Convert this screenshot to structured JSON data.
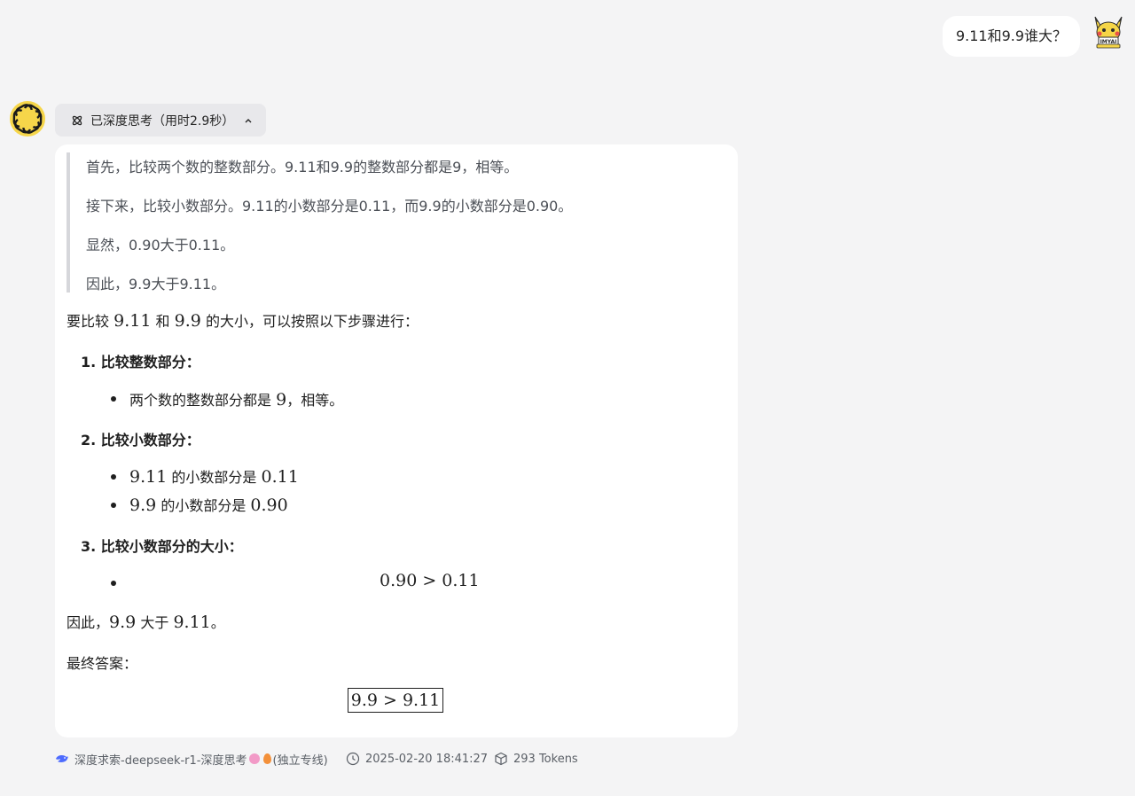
{
  "user_message": {
    "text": "9.11和9.9谁大？",
    "avatar_label": "IMYAI"
  },
  "thinking": {
    "label": "已深度思考（用时2.9秒）",
    "expanded": true,
    "lines": [
      "首先，比较两个数的整数部分。9.11和9.9的整数部分都是9，相等。",
      "接下来，比较小数部分。9.11的小数部分是0.11，而9.9的小数部分是0.90。",
      "显然，0.90大于0.11。",
      "因此，9.9大于9.11。"
    ]
  },
  "answer": {
    "intro": {
      "pre": "要比较",
      "a": "9.11",
      "mid": "和",
      "b": "9.9",
      "post": "的大小，可以按照以下步骤进行："
    },
    "step1": {
      "title": "1. 比较整数部分：",
      "bullet_pre": "两个数的整数部分都是",
      "bullet_num": "9",
      "bullet_post": "，相等。"
    },
    "step2": {
      "title": "2. 比较小数部分：",
      "b1_num": "9.11",
      "b1_text": "的小数部分是",
      "b1_val": "0.11",
      "b2_num": "9.9",
      "b2_text": "的小数部分是",
      "b2_val": "0.90"
    },
    "step3": {
      "title": "3. 比较小数部分的大小：",
      "formula": "0.90 > 0.11"
    },
    "conclusion": {
      "pre": "因此，",
      "a": "9.9",
      "mid": "大于",
      "b": "9.11",
      "post": "。"
    },
    "final_label": "最终答案：",
    "final_boxed": "9.9 > 9.11"
  },
  "footer": {
    "model": "深度求索-deepseek-r1-深度思考",
    "model_suffix": "(独立专线)",
    "timestamp": "2025-02-20 18:41:27",
    "tokens": "293 Tokens"
  },
  "colors": {
    "page_bg": "#f4f4f5",
    "card_bg": "#ffffff",
    "toggle_bg": "#e8e8eb",
    "avatar_yellow": "#f5d547",
    "accent_blue": "#4d6bfe"
  }
}
